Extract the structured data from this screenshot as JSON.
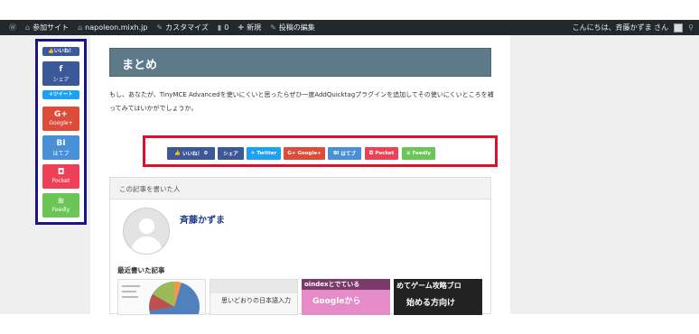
{
  "admin_bar": {
    "site_name": "参加サイト",
    "site_domain": "napoleon.mixh.jp",
    "customize": "カスタマイズ",
    "comments_count": "0",
    "new_label": "新規",
    "edit_post": "投稿の編集",
    "greeting": "こんにちは、斉藤かずま さん"
  },
  "side_share": {
    "like": "いいね！",
    "share_label": "シェア",
    "tweet": "ツイート",
    "google_label": "Google+",
    "hatena_glyph": "BI",
    "hatena_label": "はてブ",
    "pocket_label": "Pocket",
    "feedly_label": "Feedly"
  },
  "article": {
    "heading": "まとめ",
    "body": "もし、あなたが、TinyMCE Advancedを使いにくいと思ったらぜひ一度AddQuicktagプラグインを追加してその使いにくいところを補ってみてはいかがでしょうか。"
  },
  "share_row": {
    "like": "いいね！",
    "like_count": "0",
    "share": "シェア",
    "twitter": "Twitter",
    "google": "Google+",
    "hatena": "はてブ",
    "pocket": "Pocket",
    "feedly": "Feedly"
  },
  "author_box": {
    "heading": "この記事を書いた人",
    "name": "斉藤かずま",
    "recent_label": "最近書いた記事",
    "thumb2_text": "思いどおりの日本語入力",
    "thumb3_text": "Googleから",
    "thumb3_top": "oindexとでている",
    "thumb4_top": "めてゲーム攻略ブロ",
    "thumb4_text": "始める方向け"
  },
  "colors": {
    "admin_bar": "#23282d",
    "heading": "#5e7a88",
    "side_border": "#1a148b",
    "row_border": "#e0102a",
    "facebook": "#3b5998",
    "twitter": "#1da1f2",
    "google": "#dd4b39",
    "hatena": "#4a90d9",
    "pocket": "#ee4056",
    "feedly": "#6cc655"
  }
}
